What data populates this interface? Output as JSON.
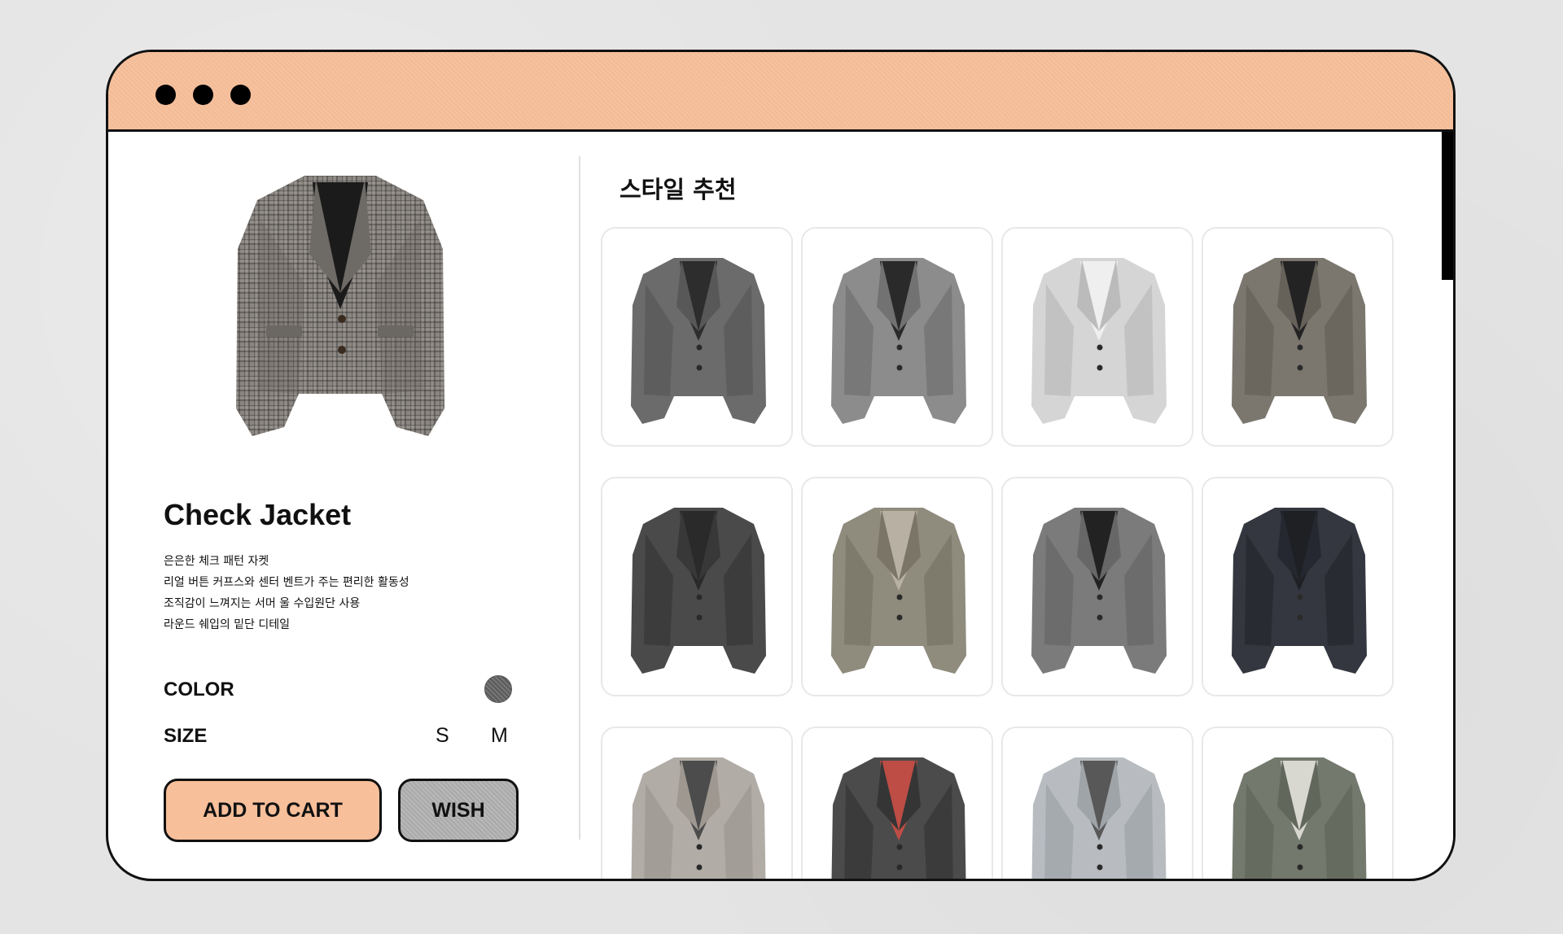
{
  "window": {
    "titlebar_color": "#f7bf9a",
    "control_dots": [
      "control-dot-1",
      "control-dot-2",
      "control-dot-3"
    ]
  },
  "product": {
    "title": "Check Jacket",
    "description": [
      "은은한 체크 패턴 자켓",
      "리얼 버튼 커프스와 센터 벤트가 주는 편리한 활동성",
      "조직감이 느껴지는 서머 울 수입원단 사용",
      "라운드 쉐입의 밑단 디테일"
    ],
    "color_label": "COLOR",
    "color_swatch": "#6c6c6c",
    "size_label": "SIZE",
    "sizes": [
      "S",
      "M"
    ],
    "add_to_cart_label": "ADD TO CART",
    "add_to_cart_color": "#f7bf9a",
    "wish_label": "WISH",
    "image_icon": "jacket-image-icon"
  },
  "recommendations": {
    "title": "스타일 추천",
    "items": [
      {
        "icon": "jacket-image-icon",
        "body": "#6b6b6b",
        "shade": "#585858",
        "inner": "#2d2d2d"
      },
      {
        "icon": "jacket-image-icon",
        "body": "#8c8c8c",
        "shade": "#727272",
        "inner": "#2a2a2a"
      },
      {
        "icon": "jacket-image-icon",
        "body": "#d5d5d5",
        "shade": "#bbbbbb",
        "inner": "#efefef"
      },
      {
        "icon": "jacket-image-icon",
        "body": "#7b776f",
        "shade": "#666159",
        "inner": "#232323"
      },
      {
        "icon": "jacket-image-icon",
        "body": "#4a4a4a",
        "shade": "#383838",
        "inner": "#2a2a2a"
      },
      {
        "icon": "jacket-image-icon",
        "body": "#8f8b7d",
        "shade": "#7a7567",
        "inner": "#b8b0a2"
      },
      {
        "icon": "jacket-image-icon",
        "body": "#7b7b7b",
        "shade": "#676767",
        "inner": "#222222"
      },
      {
        "icon": "jacket-image-icon",
        "body": "#34373f",
        "shade": "#252830",
        "inner": "#1f2024"
      },
      {
        "icon": "jacket-image-icon",
        "body": "#b2aca6",
        "shade": "#9e9891",
        "inner": "#4c4c4c"
      },
      {
        "icon": "jacket-image-icon",
        "body": "#4b4b4b",
        "shade": "#353535",
        "inner": "#bd4d45"
      },
      {
        "icon": "jacket-image-icon",
        "body": "#b8bcc0",
        "shade": "#9fa4a9",
        "inner": "#585858"
      },
      {
        "icon": "jacket-image-icon",
        "body": "#74796d",
        "shade": "#62675c",
        "inner": "#d8d8d0"
      }
    ]
  },
  "scrollbar": {
    "position": 0
  }
}
